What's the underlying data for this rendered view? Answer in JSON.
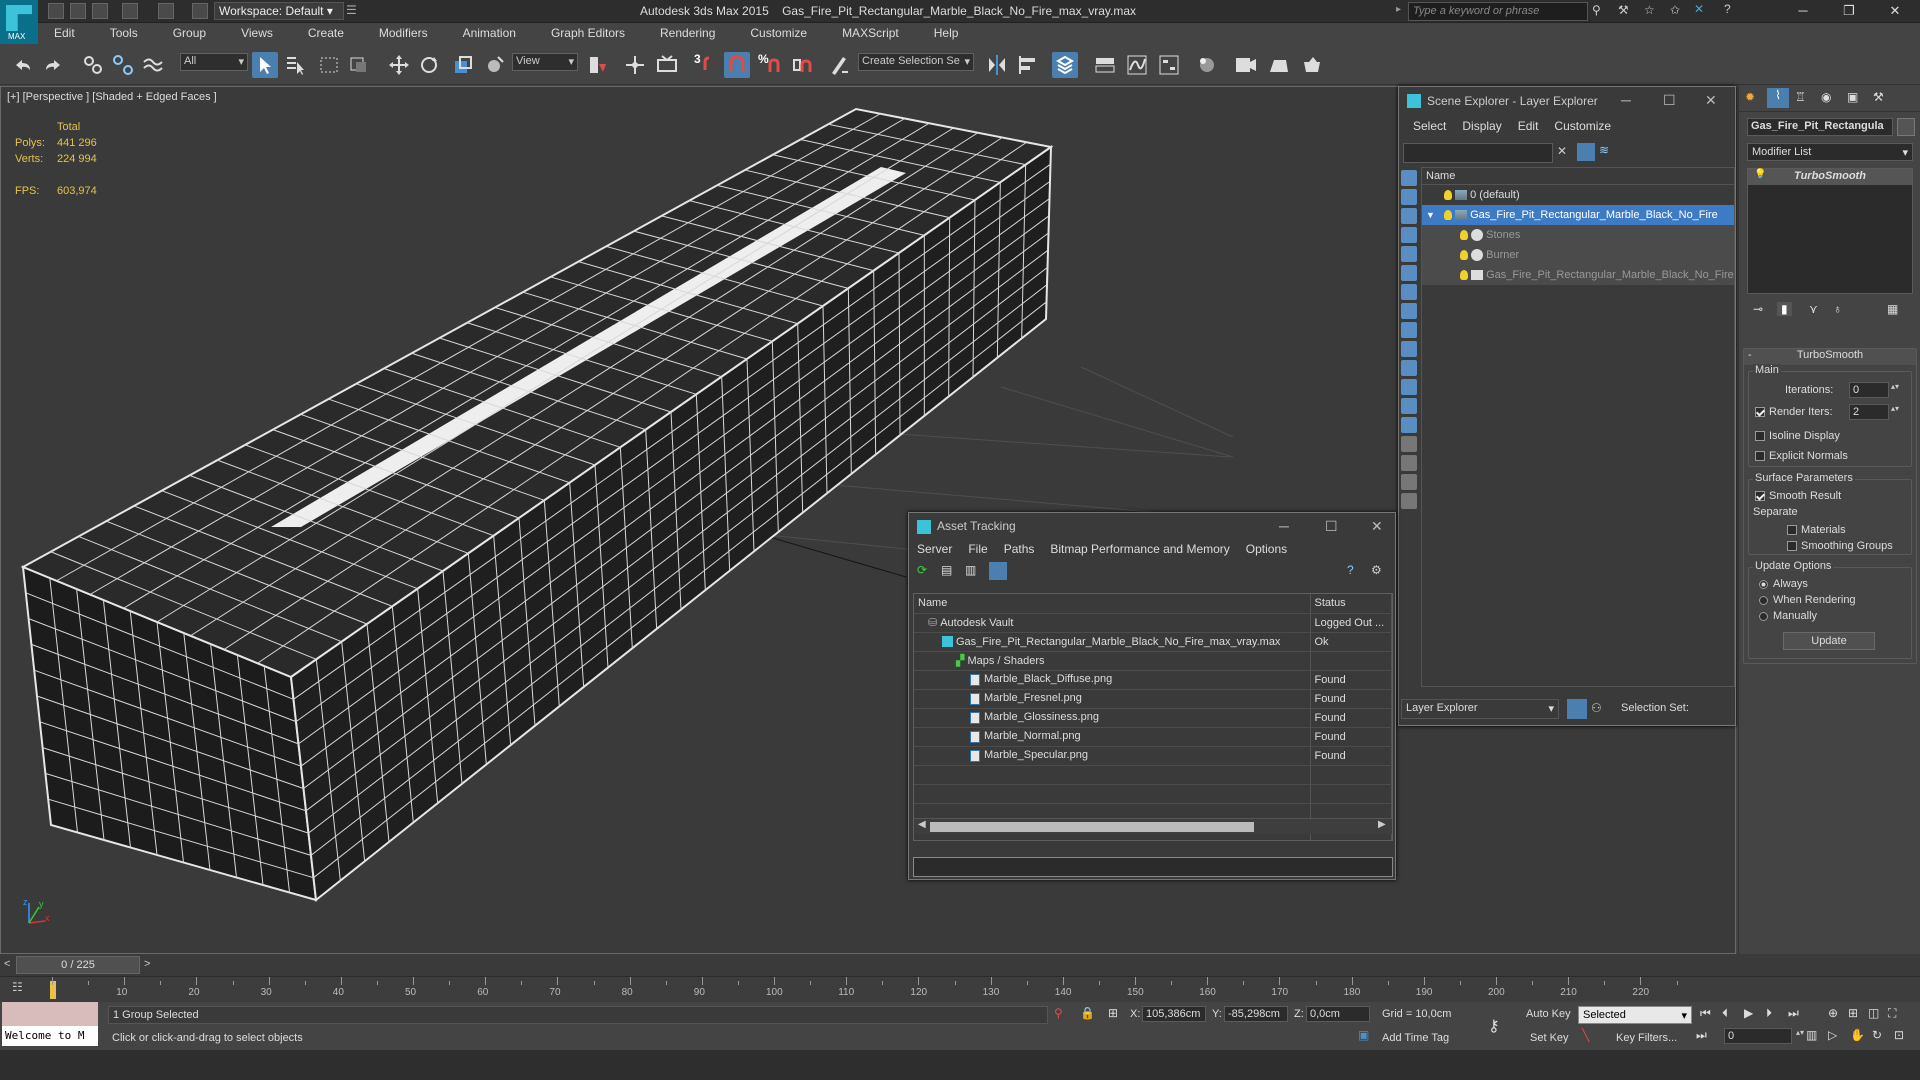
{
  "app": {
    "title": "Autodesk 3ds Max 2015",
    "filename": "Gas_Fire_Pit_Rectangular_Marble_Black_No_Fire_max_vray.max",
    "logo_text": "MAX",
    "workspace": "Workspace: Default",
    "search_placeholder": "Type a keyword or phrase"
  },
  "menu": [
    "Edit",
    "Tools",
    "Group",
    "Views",
    "Create",
    "Modifiers",
    "Animation",
    "Graph Editors",
    "Rendering",
    "Customize",
    "MAXScript",
    "Help"
  ],
  "toolbar": {
    "filter": "All",
    "coord": "View",
    "selection_set_placeholder": "Create Selection Se",
    "snap_3": "3",
    "percent": "%"
  },
  "viewport": {
    "label": "[+] [Perspective ] [Shaded + Edged Faces ]",
    "stats": {
      "total_label": "Total",
      "polys_label": "Polys:",
      "polys": "441 296",
      "verts_label": "Verts:",
      "verts": "224 994",
      "fps_label": "FPS:",
      "fps": "603,974"
    },
    "axes": {
      "x": "x",
      "y": "y",
      "z": "z"
    }
  },
  "scene_explorer": {
    "title": "Scene Explorer - Layer Explorer",
    "menu": [
      "Select",
      "Display",
      "Edit",
      "Customize"
    ],
    "col_name": "Name",
    "items": [
      {
        "label": "0 (default)",
        "type": "layer",
        "level": 0
      },
      {
        "label": "Gas_Fire_Pit_Rectangular_Marble_Black_No_Fire",
        "type": "layer",
        "level": 0,
        "selected": true
      },
      {
        "label": "Stones",
        "type": "object",
        "level": 1
      },
      {
        "label": "Burner",
        "type": "object",
        "level": 1
      },
      {
        "label": "Gas_Fire_Pit_Rectangular_Marble_Black_No_Fire",
        "type": "group",
        "level": 1
      }
    ],
    "footer_dropdown": "Layer Explorer",
    "selection_set_label": "Selection Set:"
  },
  "asset_tracking": {
    "title": "Asset Tracking",
    "menu": [
      "Server",
      "File",
      "Paths",
      "Bitmap Performance and Memory",
      "Options"
    ],
    "col_name": "Name",
    "col_status": "Status",
    "rows": [
      {
        "name": "Autodesk Vault",
        "status": "Logged Out ...",
        "level": 0,
        "icon": "vault"
      },
      {
        "name": "Gas_Fire_Pit_Rectangular_Marble_Black_No_Fire_max_vray.max",
        "status": "Ok",
        "level": 1,
        "icon": "max"
      },
      {
        "name": "Maps / Shaders",
        "status": "",
        "level": 2,
        "icon": "maps"
      },
      {
        "name": "Marble_Black_Diffuse.png",
        "status": "Found",
        "level": 3,
        "icon": "file"
      },
      {
        "name": "Marble_Fresnel.png",
        "status": "Found",
        "level": 3,
        "icon": "file"
      },
      {
        "name": "Marble_Glossiness.png",
        "status": "Found",
        "level": 3,
        "icon": "file"
      },
      {
        "name": "Marble_Normal.png",
        "status": "Found",
        "level": 3,
        "icon": "file"
      },
      {
        "name": "Marble_Specular.png",
        "status": "Found",
        "level": 3,
        "icon": "file"
      },
      {
        "name": "",
        "status": "",
        "level": 0,
        "icon": ""
      },
      {
        "name": "",
        "status": "",
        "level": 0,
        "icon": ""
      },
      {
        "name": "",
        "status": "",
        "level": 0,
        "icon": ""
      },
      {
        "name": "",
        "status": "",
        "level": 0,
        "icon": ""
      }
    ]
  },
  "command_panel": {
    "object_name": "Gas_Fire_Pit_Rectangula",
    "modifier_list": "Modifier List",
    "stack_item": "TurboSmooth",
    "rollout_title": "TurboSmooth",
    "main_label": "Main",
    "iterations_label": "Iterations:",
    "iterations": "0",
    "render_iters_label": "Render Iters:",
    "render_iters": "2",
    "render_iters_checked": true,
    "isoline_label": "Isoline Display",
    "explicit_normals_label": "Explicit Normals",
    "surface_params_label": "Surface Parameters",
    "smooth_result_label": "Smooth Result",
    "separate_label": "Separate",
    "materials_label": "Materials",
    "smoothing_groups_label": "Smoothing Groups",
    "update_options_label": "Update Options",
    "always_label": "Always",
    "when_rendering_label": "When Rendering",
    "manually_label": "Manually",
    "update_button": "Update"
  },
  "timeline": {
    "frame": "0 / 225",
    "prev": "<",
    "next": ">",
    "ticks": [
      "10",
      "20",
      "30",
      "40",
      "50",
      "60",
      "70",
      "80",
      "90",
      "100",
      "110",
      "120",
      "130",
      "140",
      "150",
      "160",
      "170",
      "180",
      "190",
      "200",
      "210",
      "220"
    ]
  },
  "status": {
    "selected": "1 Group Selected",
    "prompt": "Click or click-and-drag to select objects",
    "maxscript": "Welcome to M",
    "x_label": "X:",
    "x": "105,386cm",
    "y_label": "Y:",
    "y": "-85,298cm",
    "z_label": "Z:",
    "z": "0,0cm",
    "grid": "Grid = 10,0cm",
    "add_time_tag": "Add Time Tag",
    "auto_key": "Auto Key",
    "set_key": "Set Key",
    "selected_dropdown": "Selected",
    "key_filters": "Key Filters...",
    "frame_field": "0"
  }
}
